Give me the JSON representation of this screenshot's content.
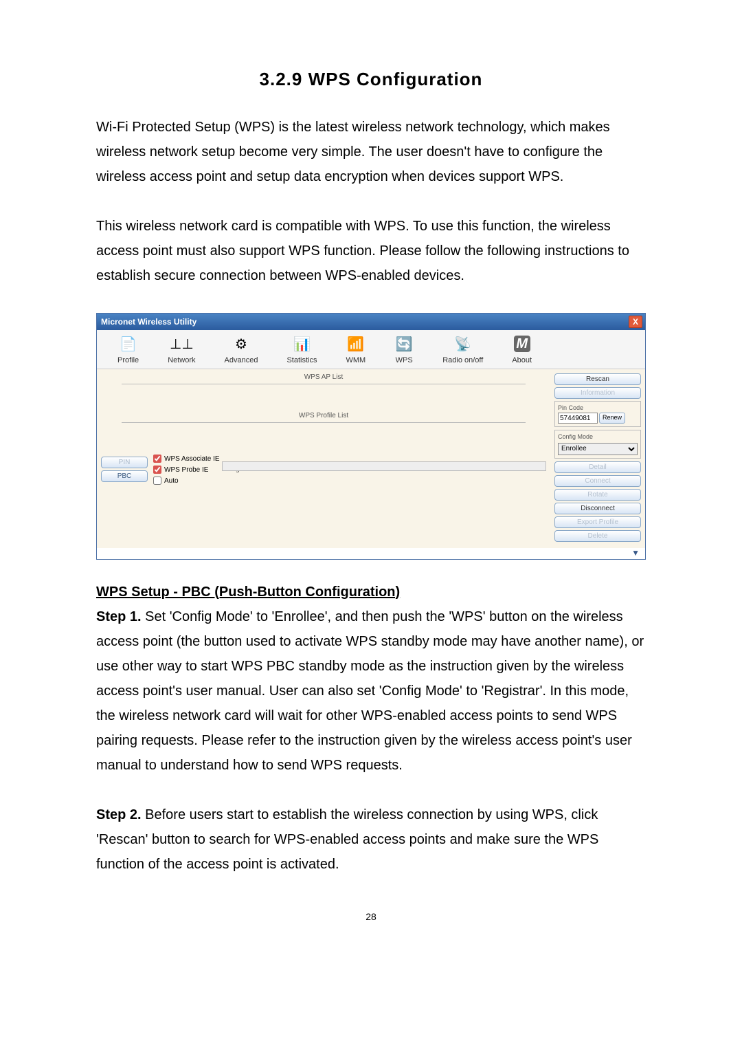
{
  "heading": "3.2.9 WPS Configuration",
  "para1": "Wi-Fi Protected Setup (WPS) is the latest wireless network technology, which makes wireless network setup become very simple. The user doesn't have to configure the wireless access point and setup data encryption when devices support WPS.",
  "para2": "This wireless network card is compatible with WPS. To use this function, the wireless access point must also support WPS function. Please follow the following instructions to establish secure connection between WPS-enabled devices.",
  "screenshot": {
    "title": "Micronet Wireless Utility",
    "close_icon": "X",
    "toolbar": {
      "profile": "Profile",
      "network": "Network",
      "advanced": "Advanced",
      "statistics": "Statistics",
      "wmm": "WMM",
      "wps": "WPS",
      "radio": "Radio on/off",
      "about": "About"
    },
    "ap_list_label": "WPS AP List",
    "profile_list_label": "WPS Profile List",
    "pin_btn": "PIN",
    "pbc_btn": "PBC",
    "wps_associate": "WPS Associate IE",
    "wps_probe": "WPS Probe IE",
    "auto_cb": "Auto",
    "progress_label": "Progress >> 0%",
    "right": {
      "rescan": "Rescan",
      "information": "Information",
      "pin_code_label": "Pin Code",
      "pin_code_value": "57449081",
      "renew": "Renew",
      "config_mode_label": "Config Mode",
      "config_mode_value": "Enrollee",
      "detail": "Detail",
      "connect": "Connect",
      "rotate": "Rotate",
      "disconnect": "Disconnect",
      "export": "Export Profile",
      "delete": "Delete"
    },
    "collapse": "▼"
  },
  "subheading": "WPS Setup - PBC (Push-Button Configuration)",
  "step1_label": "Step 1.",
  "step1_text": " Set 'Config Mode' to 'Enrollee', and then push the 'WPS' button on the wireless access point (the button used to activate WPS standby mode may have another name), or use other way to start WPS PBC standby mode as the instruction given by the wireless access point's user manual. User can also set 'Config Mode' to 'Registrar'. In this mode, the wireless network card will wait for other WPS-enabled access points to send WPS pairing requests. Please refer to the instruction given by the wireless access point's user manual to understand how to send WPS requests.",
  "step2_label": "Step 2.",
  "step2_text": " Before users start to establish the wireless connection by using WPS, click 'Rescan' button to search for WPS-enabled access points and make sure the WPS function of the access point is activated.",
  "page_number": "28"
}
